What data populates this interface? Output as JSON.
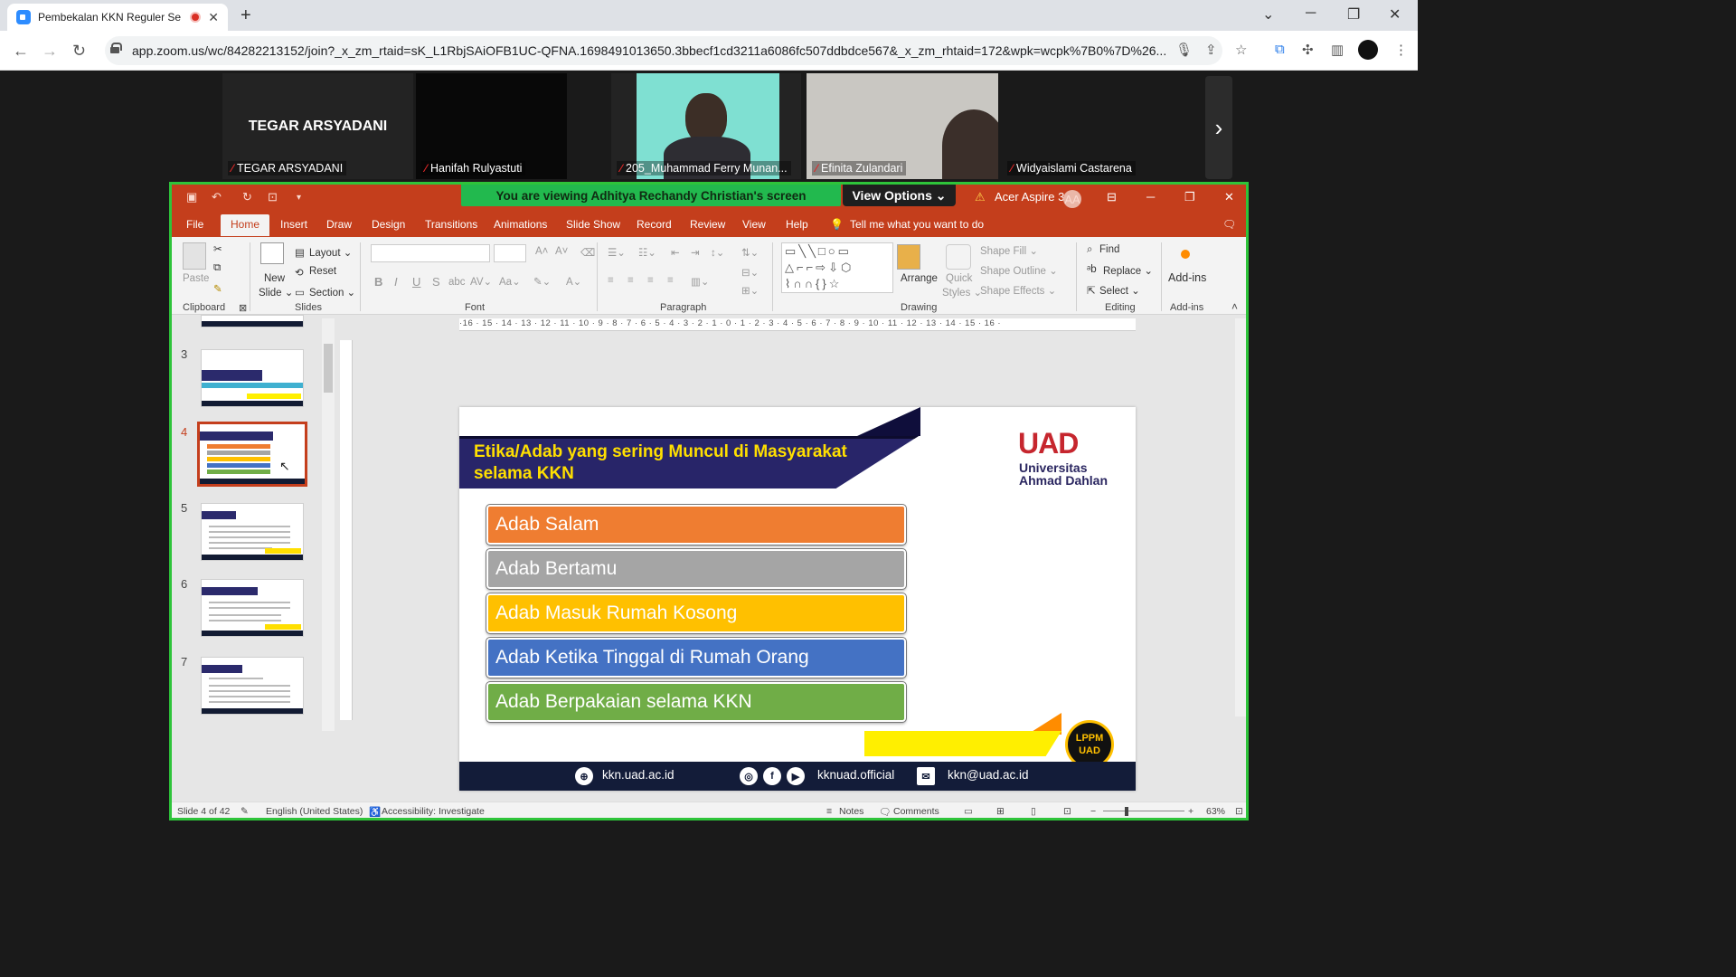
{
  "browser": {
    "tab_title": "Pembekalan KKN Reguler Se",
    "tab_close": "✕",
    "new_tab": "+",
    "url": "app.zoom.us/wc/84282213152/join?_x_zm_rtaid=sK_L1RbjSAiOFB1UC-QFNA.1698491013650.3bbecf1cd3211a6086fc507ddbdce567&_x_zm_rhtaid=172&wpk=wcpk%7B0%7D%26...",
    "win_min": "─",
    "win_max": "❐",
    "win_close": "✕",
    "tab_list": "⌄",
    "back": "←",
    "forward": "→",
    "reload": "↻",
    "mic": "🎙",
    "share": "⇪",
    "star": "☆",
    "ext": "⧉",
    "puzzle": "✣",
    "sidepanel": "▥",
    "menu": "⋮"
  },
  "participants": {
    "big_name": "TEGAR ARSYADANI",
    "tiles": [
      {
        "name": "TEGAR ARSYADANI"
      },
      {
        "name": "Hanifah Rulyastuti"
      },
      {
        "name": "205_Muhammad Ferry Munan..."
      },
      {
        "name": "Efinita Zulandari"
      },
      {
        "name": "Widyaislami Castarena"
      }
    ],
    "mute_glyph": "⁄",
    "next": "›"
  },
  "share": {
    "viewing_text": "You are viewing  Adhitya Rechandy Christian's screen",
    "view_options": "View Options ⌄",
    "account": "Acer Aspire 3",
    "avatar": "AA",
    "warn": "⚠"
  },
  "ppt": {
    "tabs": [
      "File",
      "Home",
      "Insert",
      "Draw",
      "Design",
      "Transitions",
      "Animations",
      "Slide Show",
      "Record",
      "Review",
      "View",
      "Help"
    ],
    "tell_me": "Tell me what you want to do",
    "ribbon": {
      "paste": "Paste",
      "new_slide": "New",
      "new_slide2": "Slide ⌄",
      "layout": "Layout ⌄",
      "reset": "Reset",
      "section": "Section ⌄",
      "arrange": "Arrange",
      "quick": "Quick",
      "styles": "Styles ⌄",
      "shape_fill": "Shape Fill ⌄",
      "shape_outline": "Shape Outline ⌄",
      "shape_effects": "Shape Effects ⌄",
      "find": "Find",
      "replace": "Replace ⌄",
      "select": "Select ⌄",
      "addins": "Add-ins",
      "bold": "B",
      "italic": "I",
      "underline": "U",
      "strike": "S",
      "groups": {
        "clipboard": "Clipboard",
        "slides": "Slides",
        "font": "Font",
        "paragraph": "Paragraph",
        "drawing": "Drawing",
        "editing": "Editing",
        "addins": "Add-ins"
      }
    },
    "thumb_numbers": [
      "3",
      "4",
      "5",
      "6",
      "7"
    ],
    "ruler_h": "·16 · 15 · 14 · 13 · 12 · 11 · 10 · 9 · 8 · 7 · 6 · 5 · 4 · 3 · 2 · 1 · 0 · 1 · 2 · 3 · 4 · 5 · 6 · 7 · 8 · 9 · 10 · 11 · 12 · 13 · 14 · 15 · 16 ·",
    "status": {
      "slide": "Slide 4 of 42",
      "language": "English (United States)",
      "accessibility": "Accessibility: Investigate",
      "notes": "Notes",
      "comments": "Comments",
      "zoom": "63%",
      "zoom_minus": "−",
      "zoom_plus": "+"
    }
  },
  "slide": {
    "title": "Etika/Adab yang sering Muncul di Masyarakat selama KKN",
    "logo_main": "UAD",
    "logo_sub1": "Universitas",
    "logo_sub2": "Ahmad Dahlan",
    "items": [
      {
        "label": "Adab Salam",
        "color": "#ef7d31"
      },
      {
        "label": "Adab Bertamu",
        "color": "#a5a5a5"
      },
      {
        "label": "Adab Masuk Rumah Kosong",
        "color": "#ffc000"
      },
      {
        "label": "Adab Ketika Tinggal di Rumah Orang",
        "color": "#4472c4"
      },
      {
        "label": "Adab Berpakaian selama KKN",
        "color": "#70ad47"
      }
    ],
    "lppm1": "LPPM",
    "lppm2": "UAD",
    "footer_web": "kkn.uad.ac.id",
    "footer_social": "kknuad.official",
    "footer_email": "kkn@uad.ac.id"
  }
}
